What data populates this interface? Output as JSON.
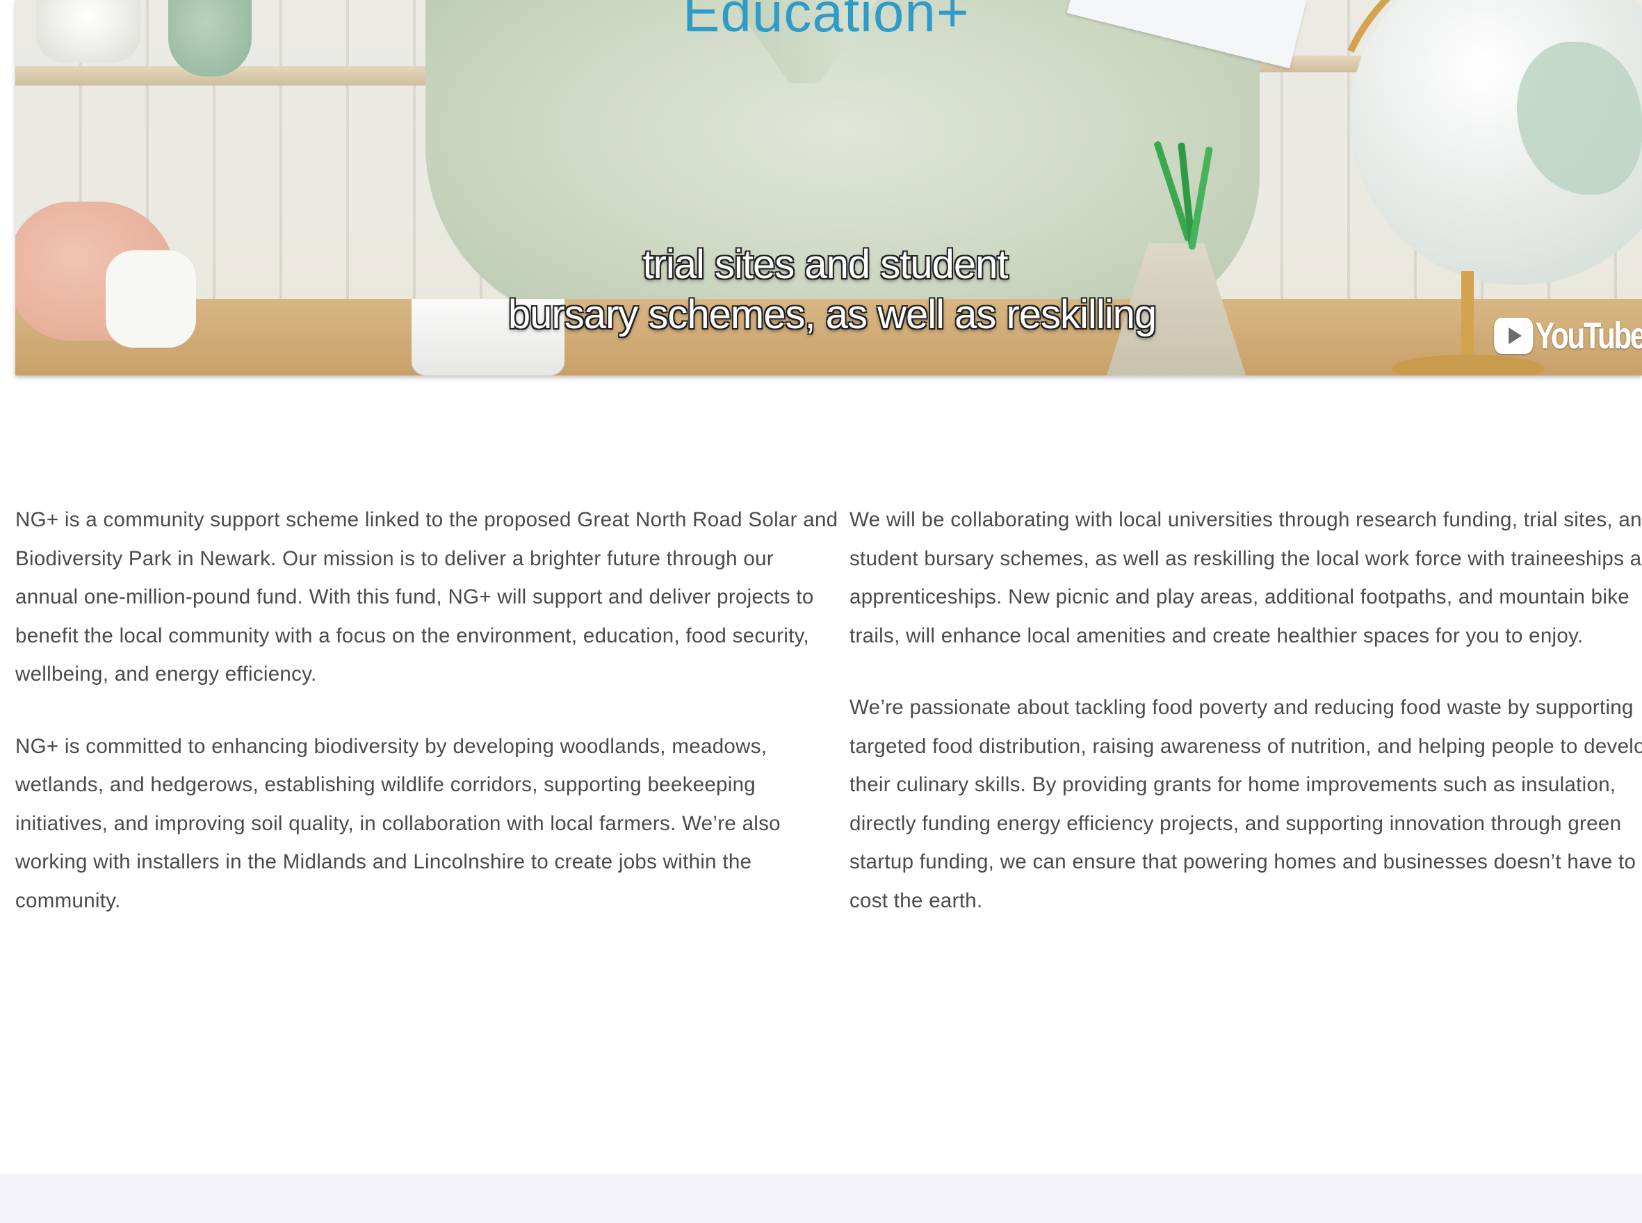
{
  "video": {
    "title_text": "Education+",
    "caption_line1": "trial sites and student",
    "caption_line2": "bursary schemes, as well as reskilling",
    "logo_text": "YouTube"
  },
  "content": {
    "left_paragraphs": [
      "NG+ is a community support scheme linked to the proposed Great North Road Solar and Biodiversity Park in Newark. Our mission is to deliver a brighter future through our annual one-million-pound fund. With this fund, NG+ will support and deliver projects to benefit the local community with a focus on the environment, education, food security, wellbeing, and energy efficiency.",
      "NG+ is committed to enhancing biodiversity by developing woodlands, meadows, wetlands, and hedgerows, establishing wildlife corridors, supporting beekeeping initiatives, and improving soil quality, in collaboration with local farmers. We’re also working with installers in the Midlands and Lincolnshire to create jobs within the community."
    ],
    "right_paragraphs": [
      "We will be collaborating with local universities through research funding, trial sites, and student bursary schemes, as well as reskilling the local work force with traineeships and apprenticeships. New picnic and play areas, additional footpaths, and mountain bike trails, will enhance local amenities and create healthier spaces for you to enjoy.",
      "We’re passionate about tackling food poverty and reducing food waste by supporting targeted food distribution, raising awareness of nutrition, and helping people to develop their culinary skills. By providing grants for home improvements such as insulation, directly funding energy efficiency projects, and supporting innovation through green startup funding, we can ensure that powering homes and businesses doesn’t have to cost the earth."
    ]
  },
  "colors": {
    "title_blue": "#2f9bc9",
    "body_text": "#4a4a4a",
    "footer_band": "#f4f4f8"
  },
  "icons": {
    "youtube": "youtube-play-icon"
  }
}
